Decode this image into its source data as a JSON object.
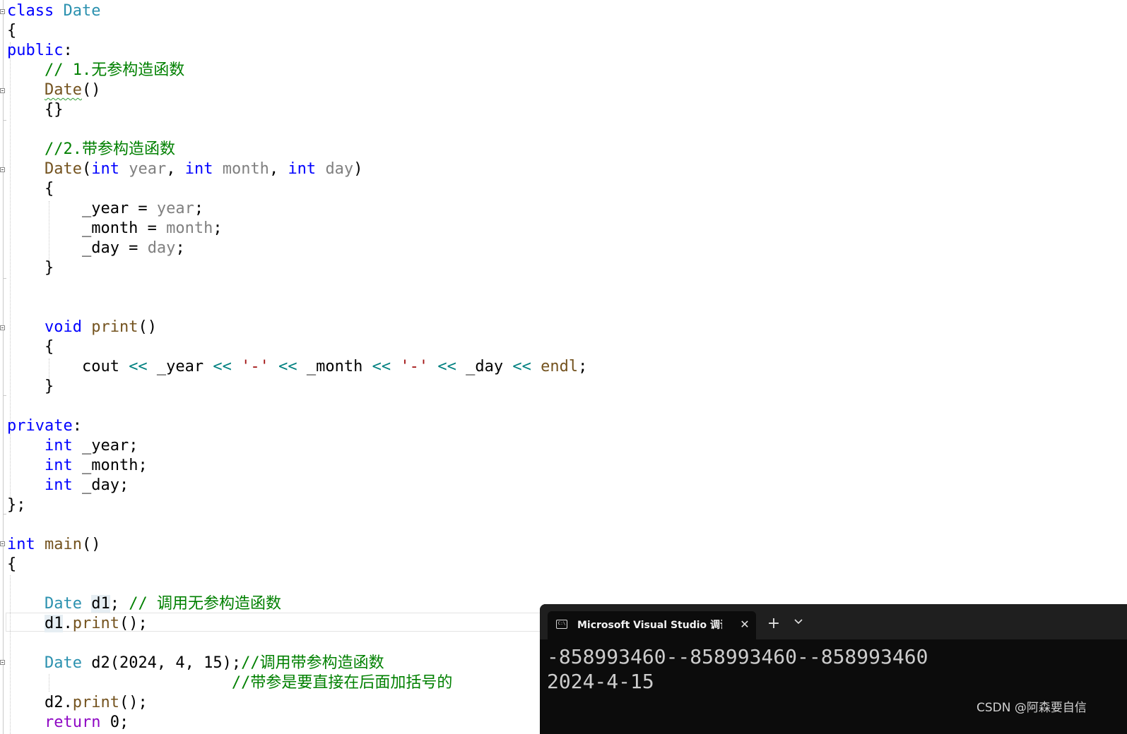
{
  "code": {
    "class_decl": "class Date",
    "comment_default_ctor": "// 1.无参构造函数",
    "comment_param_ctor": "//2.带参构造函数",
    "comment_d1": "// 调用无参构造函数",
    "comment_d2": "//调用带参构造函数",
    "comment_d2_note": "//带参是要直接在后面加括号的"
  },
  "terminal": {
    "tab_title": "Microsoft Visual Studio 调试控制台",
    "output": [
      "-858993460--858993460--858993460",
      "2024-4-15"
    ]
  },
  "watermark": "CSDN @阿森要自信",
  "icons": {
    "tab": "console-icon",
    "close": "close-icon",
    "new_tab": "plus-icon",
    "dropdown": "chevron-down-icon"
  },
  "colors": {
    "keyword": "#0000ff",
    "type": "#2b91af",
    "comment": "#008000",
    "function": "#74531f",
    "parameter": "#808080",
    "string": "#a31515",
    "terminal_bg": "#0c0c0c"
  }
}
